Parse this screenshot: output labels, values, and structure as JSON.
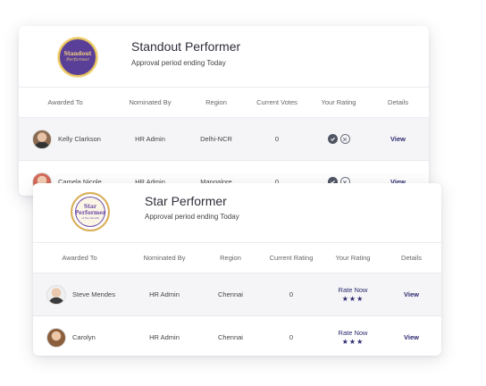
{
  "card1": {
    "badge_title": "Standout",
    "badge_sub": "Performer",
    "title": "Standout Performer",
    "subtitle": "Approval period ending Today",
    "columns": [
      "Awarded To",
      "Nominated By",
      "Region",
      "Current Votes",
      "Your Rating",
      "Details"
    ],
    "rows": [
      {
        "name": "Kelly Clarkson",
        "nominated_by": "HR Admin",
        "region": "Delhi-NCR",
        "votes": "0",
        "details": "View"
      },
      {
        "name": "Camela Nicole",
        "nominated_by": "HR Admin",
        "region": "Mangalore",
        "votes": "0",
        "details": "View"
      }
    ]
  },
  "card2": {
    "badge_title": "Star Performer",
    "badge_sub": "of the Month",
    "title": "Star Performer",
    "subtitle": "Approval period ending Today",
    "columns": [
      "Awarded To",
      "Nominated By",
      "Region",
      "Current Rating",
      "Your Rating",
      "Details"
    ],
    "rows": [
      {
        "name": "Steve Mendes",
        "nominated_by": "HR Admin",
        "region": "Chennai",
        "rating": "0",
        "rate_label": "Rate Now",
        "stars": "★★★",
        "details": "View"
      },
      {
        "name": "Carolyn",
        "nominated_by": "HR Admin",
        "region": "Chennai",
        "rating": "0",
        "rate_label": "Rate Now",
        "stars": "★★★",
        "details": "View"
      }
    ]
  },
  "icons": {
    "approve": "check-circle-icon",
    "reject": "x-circle-icon",
    "star": "star-icon"
  },
  "colors": {
    "accent": "#2c2a6e",
    "badge_purple": "#5a3f99",
    "badge_gold": "#e7c35b"
  }
}
